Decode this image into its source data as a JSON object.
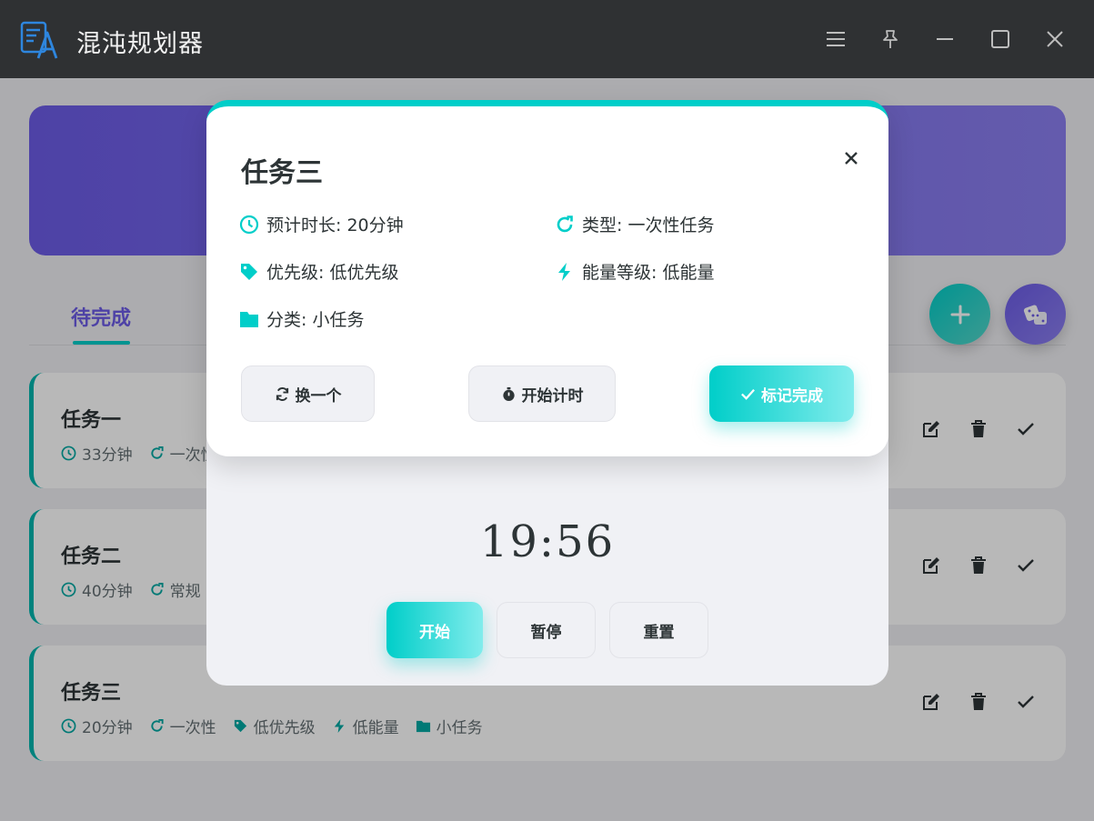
{
  "app": {
    "title": "混沌规划器"
  },
  "tabs": {
    "active_label": "待完成"
  },
  "tasks": [
    {
      "name": "任务一",
      "duration": "33分钟",
      "type": "一次性",
      "priority": "",
      "energy": "",
      "category": ""
    },
    {
      "name": "任务二",
      "duration": "40分钟",
      "type": "常规",
      "priority": "",
      "energy": "",
      "category": ""
    },
    {
      "name": "任务三",
      "duration": "20分钟",
      "type": "一次性",
      "priority": "低优先级",
      "energy": "低能量",
      "category": "小任务"
    }
  ],
  "timer": {
    "display": "19:56",
    "start_label": "开始",
    "pause_label": "暂停",
    "reset_label": "重置"
  },
  "modal": {
    "title": "任务三",
    "duration": "预计时长: 20分钟",
    "type": "类型: 一次性任务",
    "priority": "优先级: 低优先级",
    "energy": "能量等级: 低能量",
    "category": "分类: 小任务",
    "swap_label": "换一个",
    "start_timer_label": "开始计时",
    "done_label": "标记完成"
  },
  "colors": {
    "accent": "#00cec9",
    "primary": "#6c5ce7",
    "titlebar": "#2f3133",
    "text": "#2d3436"
  },
  "icons": [
    "app-logo",
    "menu-icon",
    "pin-icon",
    "minimize-icon",
    "maximize-icon",
    "close-icon",
    "plus-icon",
    "dice-icon",
    "clock-icon",
    "redo-icon",
    "tag-icon",
    "bolt-icon",
    "folder-icon",
    "edit-icon",
    "trash-icon",
    "check-icon",
    "sync-icon",
    "stopwatch-icon"
  ]
}
